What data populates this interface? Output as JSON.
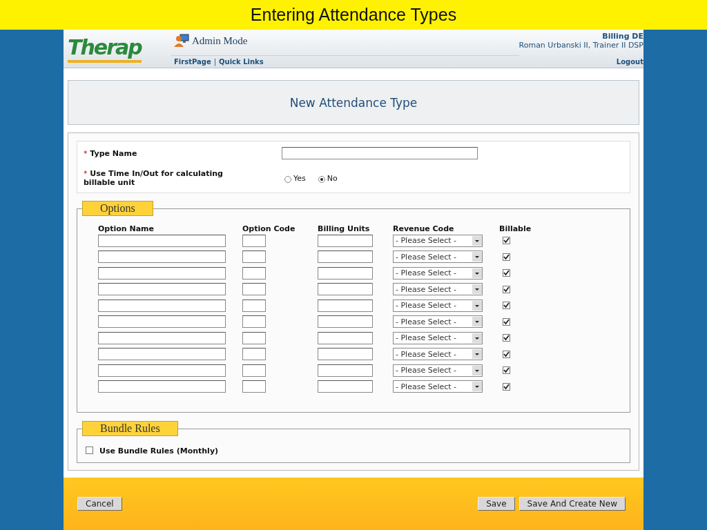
{
  "slide_title": "Entering Attendance Types",
  "header": {
    "logo": "Therap",
    "mode": "Admin Mode",
    "links": [
      "FirstPage",
      "|",
      "Quick Links"
    ],
    "organization": "Billing DE",
    "user": "Roman Urbanski II, Trainer II DSP",
    "logout": "Logout"
  },
  "page_title": "New Attendance Type",
  "type_form": {
    "required_mark": "*",
    "type_name_label": "Type Name",
    "time_label": "Use Time In/Out for calculating billable unit",
    "time_options": [
      {
        "label": "Yes",
        "selected": false
      },
      {
        "label": "No",
        "selected": true
      }
    ]
  },
  "options": {
    "legend": "Options",
    "columns": [
      "Option Name",
      "Option Code",
      "Billing Units",
      "Revenue Code",
      "Billable"
    ],
    "rows": [
      {
        "revenue_code": "- Please Select -",
        "billable": true
      },
      {
        "revenue_code": "- Please Select -",
        "billable": true
      },
      {
        "revenue_code": "- Please Select -",
        "billable": true
      },
      {
        "revenue_code": "- Please Select -",
        "billable": true
      },
      {
        "revenue_code": "- Please Select -",
        "billable": true
      },
      {
        "revenue_code": "- Please Select -",
        "billable": true
      },
      {
        "revenue_code": "- Please Select -",
        "billable": true
      },
      {
        "revenue_code": "- Please Select -",
        "billable": true
      },
      {
        "revenue_code": "- Please Select -",
        "billable": true
      },
      {
        "revenue_code": "- Please Select -",
        "billable": true
      }
    ]
  },
  "bundle_rules": {
    "legend": "Bundle Rules",
    "label": "Use Bundle Rules (Monthly)",
    "checked": false
  },
  "buttons": {
    "cancel": "Cancel",
    "save": "Save",
    "save_and_new": "Save And Create New"
  }
}
